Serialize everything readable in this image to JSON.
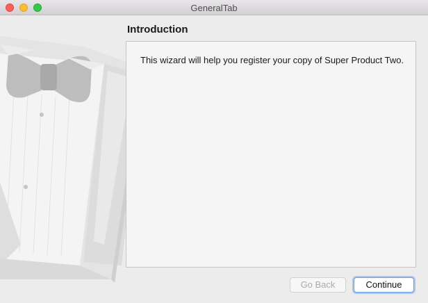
{
  "window": {
    "title": "GeneralTab"
  },
  "sidebar_art": {
    "icon": "tuxedo-illustration"
  },
  "page": {
    "heading": "Introduction",
    "body": "This wizard will help you register your copy of Super Product Two."
  },
  "buttons": {
    "back_label": "Go Back",
    "back_enabled": false,
    "continue_label": "Continue"
  },
  "colors": {
    "window_bg": "#ececec",
    "content_bg": "#f5f5f5",
    "focus_ring": "#6a9fe3"
  }
}
